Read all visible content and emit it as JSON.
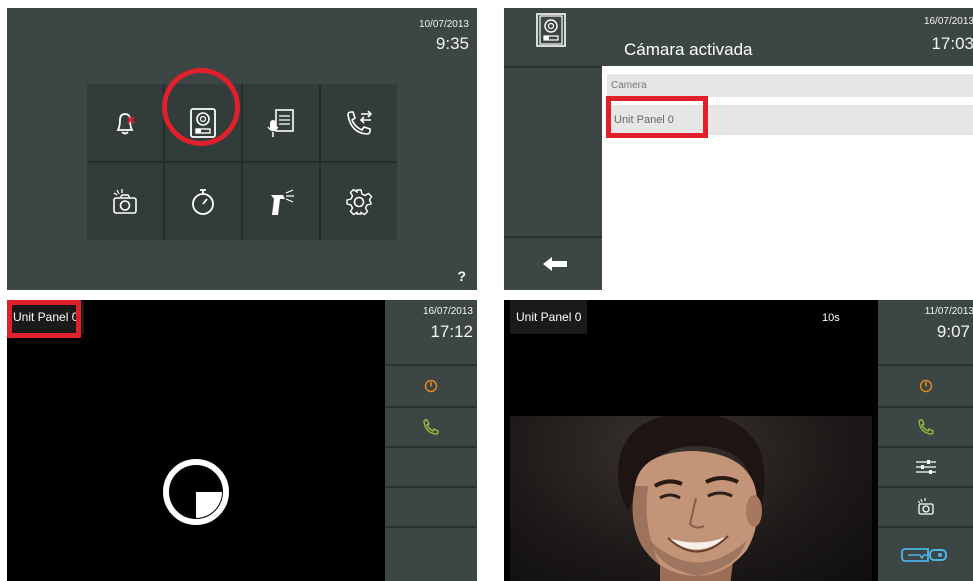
{
  "panel1": {
    "date": "10/07/2013",
    "time": "9:35",
    "help": "?",
    "tiles": [
      {
        "icon": "bell-mute-icon"
      },
      {
        "icon": "camera-unit-icon"
      },
      {
        "icon": "memo-icon"
      },
      {
        "icon": "call-transfer-icon"
      },
      {
        "icon": "photo-camera-icon"
      },
      {
        "icon": "timer-icon"
      },
      {
        "icon": "cleaning-icon"
      },
      {
        "icon": "settings-icon"
      }
    ],
    "highlight_color": "#e0202a"
  },
  "panel2": {
    "date": "16/07/2013",
    "time": "17:03",
    "title": "Cámara activada",
    "list_header": "Camera",
    "list_items": [
      "Unit Panel 0"
    ],
    "back_icon": "back-arrow-icon"
  },
  "panel3": {
    "date": "16/07/2013",
    "time": "17:12",
    "unit": "Unit Panel 0",
    "status_icon": "loading-icon",
    "side_icons": [
      "power-icon",
      "phone-icon"
    ]
  },
  "panel4": {
    "date": "11/07/2013",
    "time": "9:07",
    "unit": "Unit Panel 0",
    "countdown": "10s",
    "side_icons": [
      "power-icon",
      "phone-icon",
      "adjust-icon",
      "snapshot-icon",
      "door-key-icon"
    ]
  },
  "colors": {
    "panel_bg": "#3c4645",
    "highlight": "#e0202a",
    "power_orange": "#e78a1a",
    "phone_green": "#93bd3c"
  }
}
